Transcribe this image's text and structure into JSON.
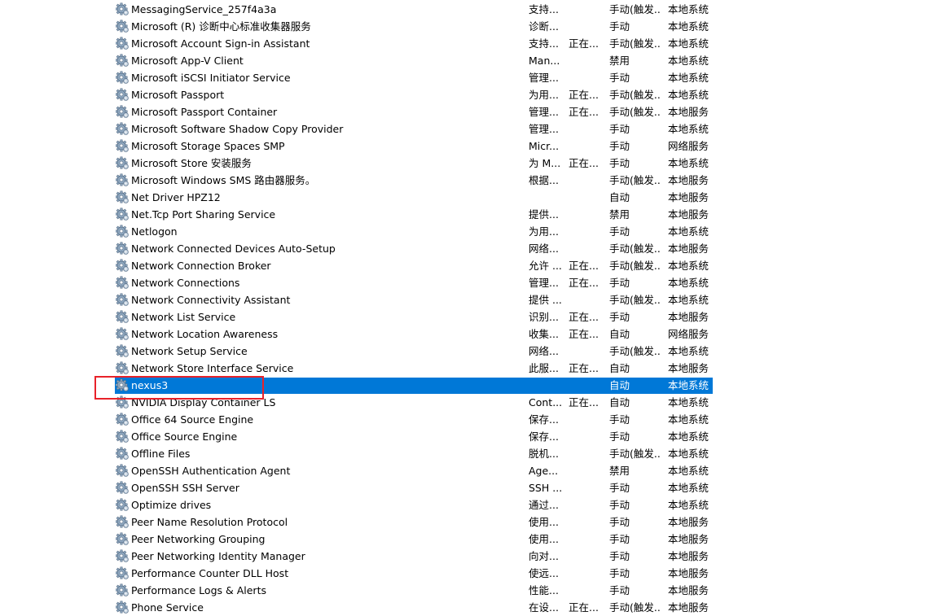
{
  "services": [
    {
      "name": "MessagingService_257f4a3a",
      "desc": "支持...",
      "status": "",
      "startup": "手动(触发...",
      "logon": "本地系统"
    },
    {
      "name": "Microsoft (R) 诊断中心标准收集器服务",
      "desc": "诊断...",
      "status": "",
      "startup": "手动",
      "logon": "本地系统"
    },
    {
      "name": "Microsoft Account Sign-in Assistant",
      "desc": "支持...",
      "status": "正在...",
      "startup": "手动(触发...",
      "logon": "本地系统"
    },
    {
      "name": "Microsoft App-V Client",
      "desc": "Man...",
      "status": "",
      "startup": "禁用",
      "logon": "本地系统"
    },
    {
      "name": "Microsoft iSCSI Initiator Service",
      "desc": "管理...",
      "status": "",
      "startup": "手动",
      "logon": "本地系统"
    },
    {
      "name": "Microsoft Passport",
      "desc": "为用...",
      "status": "正在...",
      "startup": "手动(触发...",
      "logon": "本地系统"
    },
    {
      "name": "Microsoft Passport Container",
      "desc": "管理...",
      "status": "正在...",
      "startup": "手动(触发...",
      "logon": "本地服务"
    },
    {
      "name": "Microsoft Software Shadow Copy Provider",
      "desc": "管理...",
      "status": "",
      "startup": "手动",
      "logon": "本地系统"
    },
    {
      "name": "Microsoft Storage Spaces SMP",
      "desc": "Micr...",
      "status": "",
      "startup": "手动",
      "logon": "网络服务"
    },
    {
      "name": "Microsoft Store 安装服务",
      "desc": "为 M...",
      "status": "正在...",
      "startup": "手动",
      "logon": "本地系统"
    },
    {
      "name": "Microsoft Windows SMS 路由器服务。",
      "desc": "根据...",
      "status": "",
      "startup": "手动(触发...",
      "logon": "本地服务"
    },
    {
      "name": "Net Driver HPZ12",
      "desc": "",
      "status": "",
      "startup": "自动",
      "logon": "本地服务"
    },
    {
      "name": "Net.Tcp Port Sharing Service",
      "desc": "提供...",
      "status": "",
      "startup": "禁用",
      "logon": "本地服务"
    },
    {
      "name": "Netlogon",
      "desc": "为用...",
      "status": "",
      "startup": "手动",
      "logon": "本地系统"
    },
    {
      "name": "Network Connected Devices Auto-Setup",
      "desc": "网络...",
      "status": "",
      "startup": "手动(触发...",
      "logon": "本地服务"
    },
    {
      "name": "Network Connection Broker",
      "desc": "允许 ...",
      "status": "正在...",
      "startup": "手动(触发...",
      "logon": "本地系统"
    },
    {
      "name": "Network Connections",
      "desc": "管理...",
      "status": "正在...",
      "startup": "手动",
      "logon": "本地系统"
    },
    {
      "name": "Network Connectivity Assistant",
      "desc": "提供 ...",
      "status": "",
      "startup": "手动(触发...",
      "logon": "本地系统"
    },
    {
      "name": "Network List Service",
      "desc": "识别...",
      "status": "正在...",
      "startup": "手动",
      "logon": "本地服务"
    },
    {
      "name": "Network Location Awareness",
      "desc": "收集...",
      "status": "正在...",
      "startup": "自动",
      "logon": "网络服务"
    },
    {
      "name": "Network Setup Service",
      "desc": "网络...",
      "status": "",
      "startup": "手动(触发...",
      "logon": "本地系统"
    },
    {
      "name": "Network Store Interface Service",
      "desc": "此服...",
      "status": "正在...",
      "startup": "自动",
      "logon": "本地服务"
    },
    {
      "name": "nexus3",
      "desc": "",
      "status": "",
      "startup": "自动",
      "logon": "本地系统",
      "selected": true
    },
    {
      "name": "NVIDIA Display Container LS",
      "desc": "Cont...",
      "status": "正在...",
      "startup": "自动",
      "logon": "本地系统"
    },
    {
      "name": "Office 64 Source Engine",
      "desc": "保存...",
      "status": "",
      "startup": "手动",
      "logon": "本地系统"
    },
    {
      "name": "Office Source Engine",
      "desc": "保存...",
      "status": "",
      "startup": "手动",
      "logon": "本地系统"
    },
    {
      "name": "Offline Files",
      "desc": "脱机...",
      "status": "",
      "startup": "手动(触发...",
      "logon": "本地系统"
    },
    {
      "name": "OpenSSH Authentication Agent",
      "desc": "Age...",
      "status": "",
      "startup": "禁用",
      "logon": "本地系统"
    },
    {
      "name": "OpenSSH SSH Server",
      "desc": "SSH ...",
      "status": "",
      "startup": "手动",
      "logon": "本地系统"
    },
    {
      "name": "Optimize drives",
      "desc": "通过...",
      "status": "",
      "startup": "手动",
      "logon": "本地系统"
    },
    {
      "name": "Peer Name Resolution Protocol",
      "desc": "使用...",
      "status": "",
      "startup": "手动",
      "logon": "本地服务"
    },
    {
      "name": "Peer Networking Grouping",
      "desc": "使用...",
      "status": "",
      "startup": "手动",
      "logon": "本地服务"
    },
    {
      "name": "Peer Networking Identity Manager",
      "desc": "向对...",
      "status": "",
      "startup": "手动",
      "logon": "本地服务"
    },
    {
      "name": "Performance Counter DLL Host",
      "desc": "使远...",
      "status": "",
      "startup": "手动",
      "logon": "本地服务"
    },
    {
      "name": "Performance Logs & Alerts",
      "desc": "性能...",
      "status": "",
      "startup": "手动",
      "logon": "本地服务"
    },
    {
      "name": "Phone Service",
      "desc": "在设...",
      "status": "正在...",
      "startup": "手动(触发...",
      "logon": "本地服务"
    }
  ],
  "colors": {
    "selection": "#0078d7",
    "annotation_box": "#e8222a"
  },
  "row_icon": "service-gear-icon"
}
